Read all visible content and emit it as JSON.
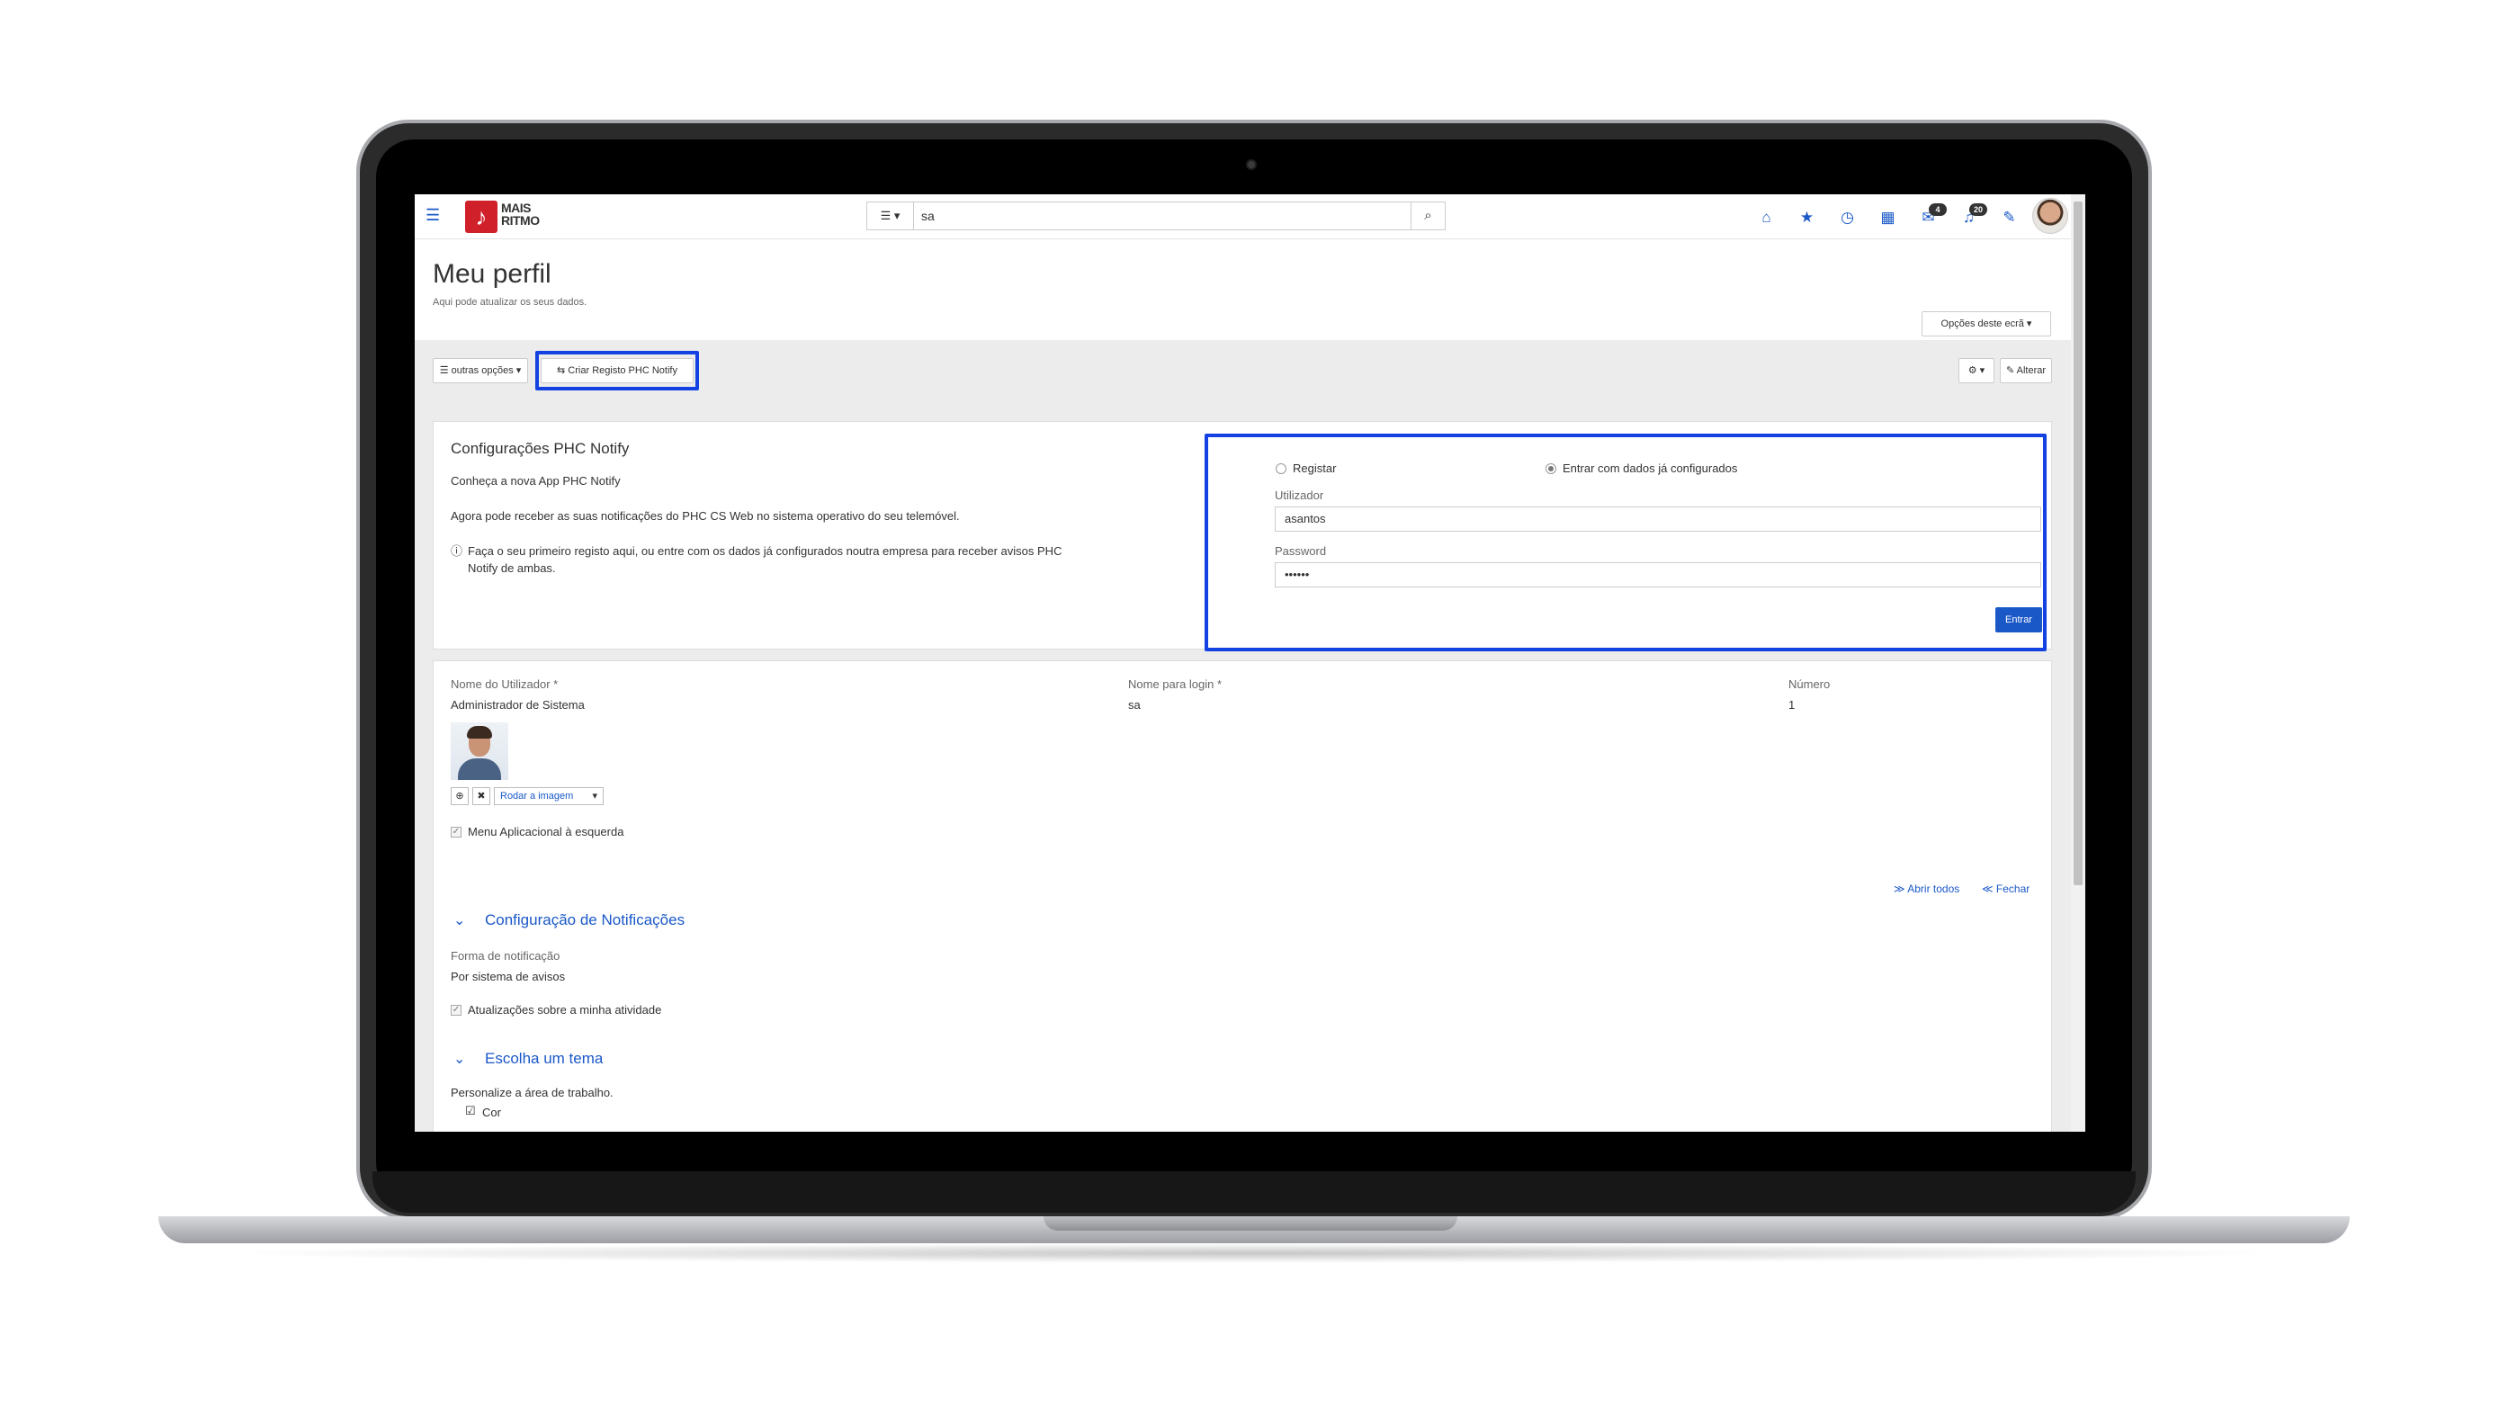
{
  "header": {
    "logo_line1": "MAIS",
    "logo_line2": "RITMO",
    "search_value": "sa",
    "badges": {
      "messages": "4",
      "notifications": "20"
    }
  },
  "page": {
    "title": "Meu perfil",
    "subtitle": "Aqui pode atualizar os seus dados.",
    "screen_options": "Opções deste ecrã ▾"
  },
  "toolbar": {
    "other_options": "☰ outras opções ▾",
    "create_registry": "⇆ Criar Registo PHC Notify",
    "settings": "⚙ ▾",
    "edit": "✎ Alterar"
  },
  "notify": {
    "title": "Configurações PHC Notify",
    "intro": "Conheça a nova App PHC Notify",
    "desc": "Agora pode receber as suas notificações do PHC CS Web no sistema operativo do seu telemóvel.",
    "info_line1": "Faça o seu primeiro registo aqui, ou entre com os dados já configurados noutra empresa para receber avisos PHC",
    "info_line2": "Notify de ambas.",
    "radio_register": "Registar",
    "radio_login": "Entrar com dados já configurados",
    "user_label": "Utilizador",
    "user_value": "asantos",
    "password_label": "Password",
    "password_value": "••••••",
    "submit": "Entrar"
  },
  "profile": {
    "name_label": "Nome do Utilizador *",
    "name_value": "Administrador de Sistema",
    "login_label": "Nome para login *",
    "login_value": "sa",
    "number_label": "Número",
    "number_value": "1",
    "rotate_select": "Rodar a imagem",
    "menu_left": "Menu Aplicacional à esquerda",
    "open_all": "≫ Abrir todos",
    "close_all": "≪ Fechar"
  },
  "notifications_section": {
    "title": "Configuração de Notificações",
    "form_label": "Forma de notificação",
    "form_value": "Por sistema de avisos",
    "activity_updates": "Atualizações sobre a minha atividade"
  },
  "theme_section": {
    "title": "Escolha um tema",
    "desc": "Personalize a área de trabalho.",
    "color_option": "Cor"
  },
  "colors": {
    "accent": "#1a58c8",
    "highlight": "#1341e2",
    "logo": "#d0202a"
  }
}
